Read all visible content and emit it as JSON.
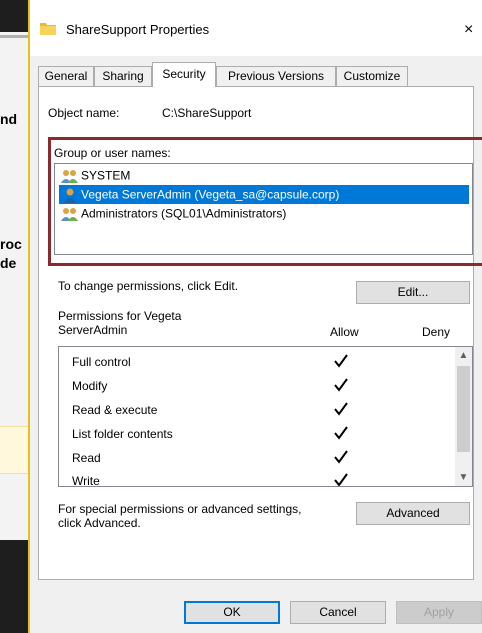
{
  "background": {
    "texts": [
      "nd",
      "roc",
      "de"
    ],
    "accent_color": "#fff8dc"
  },
  "dialog": {
    "title": "ShareSupport Properties",
    "close_icon": "close-icon",
    "close_glyph": "×",
    "tabs": [
      {
        "label": "General",
        "active": false
      },
      {
        "label": "Sharing",
        "active": false
      },
      {
        "label": "Security",
        "active": true
      },
      {
        "label": "Previous Versions",
        "active": false
      },
      {
        "label": "Customize",
        "active": false
      }
    ]
  },
  "security": {
    "object_name_label": "Object name:",
    "object_name_value": "C:\\ShareSupport",
    "group_label": "Group or user names:",
    "users": [
      {
        "name": "SYSTEM",
        "icon": "users-group-icon",
        "selected": false
      },
      {
        "name": "Vegeta ServerAdmin (Vegeta_sa@capsule.corp)",
        "icon": "user-icon",
        "selected": true
      },
      {
        "name": "Administrators (SQL01\\Administrators)",
        "icon": "users-group-icon",
        "selected": false
      }
    ],
    "highlight_color": "#8b2a2e",
    "change_label": "To change permissions, click Edit.",
    "edit_button": "Edit...",
    "permissions_for_line1": "Permissions for Vegeta",
    "permissions_for_line2": "ServerAdmin",
    "allow_header": "Allow",
    "deny_header": "Deny",
    "permissions": [
      {
        "name": "Full control",
        "allow": true,
        "deny": false
      },
      {
        "name": "Modify",
        "allow": true,
        "deny": false
      },
      {
        "name": "Read & execute",
        "allow": true,
        "deny": false
      },
      {
        "name": "List folder contents",
        "allow": true,
        "deny": false
      },
      {
        "name": "Read",
        "allow": true,
        "deny": false
      },
      {
        "name": "Write",
        "allow": true,
        "deny": false
      }
    ],
    "special_line1": "For special permissions or advanced settings,",
    "special_line2": "click Advanced.",
    "advanced_button": "Advanced"
  },
  "footer": {
    "ok": "OK",
    "cancel": "Cancel",
    "apply": "Apply"
  },
  "colors": {
    "selection": "#0078d7",
    "dialog_bg": "#f0f0f0"
  }
}
